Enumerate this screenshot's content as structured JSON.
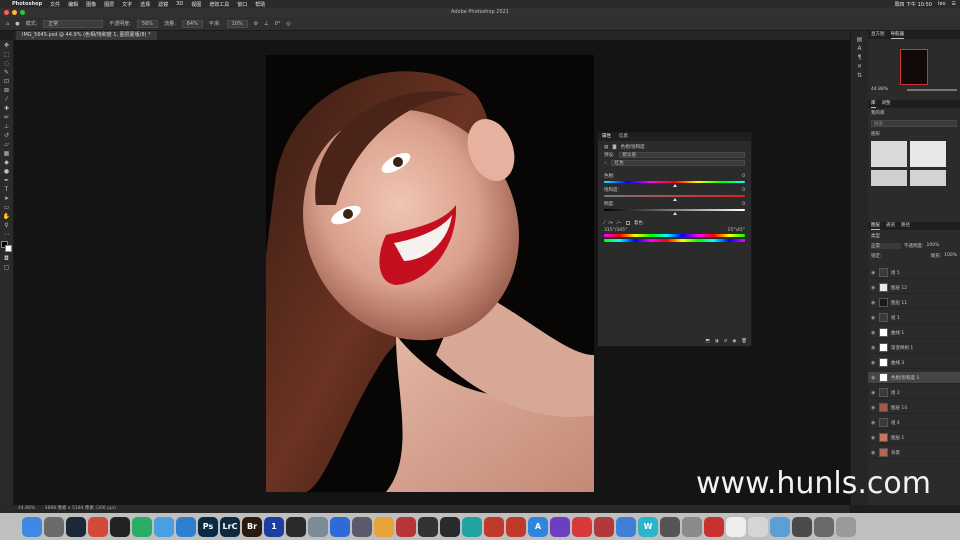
{
  "menubar": {
    "app": "Photoshop",
    "items": [
      "文件",
      "编辑",
      "图像",
      "图层",
      "文字",
      "选择",
      "滤镜",
      "3D",
      "视图",
      "增效工具",
      "窗口",
      "帮助"
    ],
    "clock": "周四 下午 10:50",
    "user": "leo"
  },
  "window": {
    "title": "Adobe Photoshop 2021"
  },
  "options": {
    "mode_label": "模式:",
    "mode_value": "正常",
    "opacity_label": "不透明度:",
    "opacity_value": "56%",
    "flow_label": "流量:",
    "flow_value": "64%",
    "smooth_label": "平滑:",
    "smooth_value": "10%",
    "angle_value": "0°"
  },
  "document": {
    "tab": "IMG_5645.psd @ 44.9% (色相/饱和度 1, 图层蒙版/8) *"
  },
  "status": {
    "zoom": "44.88%",
    "info": "3888 像素 x 5184 像素 (300 ppi)"
  },
  "properties": {
    "tab_properties": "属性",
    "tab_info": "信息",
    "title": "色相/饱和度",
    "preset_label": "预设:",
    "preset_value": "默认值",
    "channel_value": "红色",
    "hue_label": "色相:",
    "hue_value": "0",
    "sat_label": "饱和度:",
    "sat_value": "0",
    "light_label": "明度:",
    "light_value": "0",
    "colorize_label": "着色",
    "range_left": "315°/345°",
    "range_right": "15°\\45°",
    "levels": {
      "hue": 0.5,
      "sat": 0.5,
      "light": 0.5
    }
  },
  "navigator": {
    "tab1": "直方图",
    "tab2": "导航器",
    "zoom": "44.88%"
  },
  "libraries": {
    "tab1": "库",
    "tab2": "调整",
    "name": "我的库",
    "search_placeholder": "搜索",
    "section": "图形"
  },
  "layers_panel": {
    "tabs": [
      "图层",
      "通道",
      "路径"
    ],
    "kind_label": "类型",
    "blend": "正常",
    "opacity_label": "不透明度:",
    "opacity_value": "100%",
    "lock_label": "锁定:",
    "fill_label": "填充:",
    "fill_value": "100%",
    "layers": [
      "组 5",
      "图层 12",
      "图层 11",
      "组 1",
      "曲线 1",
      "渐变映射 1",
      "曲线 3",
      "色相/饱和度 1",
      "组 2",
      "图层 14",
      "组 4",
      "图层 1",
      "背景"
    ]
  },
  "dock": {
    "apps": [
      {
        "name": "finder",
        "label": "",
        "color": "#3d8be0"
      },
      {
        "name": "launchpad",
        "label": "",
        "color": "#6b6b6b"
      },
      {
        "name": "steam",
        "label": "",
        "color": "#1b2838"
      },
      {
        "name": "chrome",
        "label": "",
        "color": "#d24a3a"
      },
      {
        "name": "qq",
        "label": "",
        "color": "#222222"
      },
      {
        "name": "wechat",
        "label": "",
        "color": "#2aae67"
      },
      {
        "name": "finder2",
        "label": "",
        "color": "#4a9fe0"
      },
      {
        "name": "edge",
        "label": "",
        "color": "#2f7fd1"
      },
      {
        "name": "photoshop",
        "label": "Ps",
        "color": "#0a2a44"
      },
      {
        "name": "lightroom",
        "label": "LrC",
        "color": "#0f2a3f"
      },
      {
        "name": "bridge",
        "label": "Br",
        "color": "#2b1a10"
      },
      {
        "name": "onepassword",
        "label": "1",
        "color": "#1a3f9e"
      },
      {
        "name": "obs",
        "label": "",
        "color": "#2a2a2a"
      },
      {
        "name": "preview",
        "label": "",
        "color": "#7d8a97"
      },
      {
        "name": "baidu",
        "label": "",
        "color": "#2e6bd8"
      },
      {
        "name": "resolve",
        "label": "",
        "color": "#5a5a6a"
      },
      {
        "name": "photos",
        "label": "",
        "color": "#e8a23a"
      },
      {
        "name": "wps",
        "label": "",
        "color": "#b73535"
      },
      {
        "name": "infuse",
        "label": "",
        "color": "#333333"
      },
      {
        "name": "finalcut",
        "label": "",
        "color": "#2a2a2a"
      },
      {
        "name": "ucloud",
        "label": "",
        "color": "#1fa3a3"
      },
      {
        "name": "screenflow",
        "label": "",
        "color": "#c0392b"
      },
      {
        "name": "netease",
        "label": "",
        "color": "#c0392b"
      },
      {
        "name": "appstore",
        "label": "A",
        "color": "#2e86de"
      },
      {
        "name": "affinity",
        "label": "",
        "color": "#6c3fc0"
      },
      {
        "name": "music",
        "label": "",
        "color": "#d63a3a"
      },
      {
        "name": "rocket",
        "label": "",
        "color": "#b03a3a"
      },
      {
        "name": "lark",
        "label": "",
        "color": "#3f7fd6"
      },
      {
        "name": "wiz",
        "label": "W",
        "color": "#2bb5c9"
      },
      {
        "name": "monitor",
        "label": "",
        "color": "#555555"
      },
      {
        "name": "settings",
        "label": "",
        "color": "#8a8a8a"
      },
      {
        "name": "creative-cloud",
        "label": "",
        "color": "#c8322e"
      },
      {
        "name": "notes",
        "label": "",
        "color": "#eeeeee"
      },
      {
        "name": "docs",
        "label": "",
        "color": "#d5d5d5"
      },
      {
        "name": "folder",
        "label": "",
        "color": "#5a9fd6"
      },
      {
        "name": "cloud-folder",
        "label": "",
        "color": "#4a4a4a"
      },
      {
        "name": "downloads",
        "label": "",
        "color": "#6a6a6a"
      },
      {
        "name": "trash",
        "label": "",
        "color": "#9a9a9a"
      }
    ]
  },
  "watermark": "www.hunls.com"
}
